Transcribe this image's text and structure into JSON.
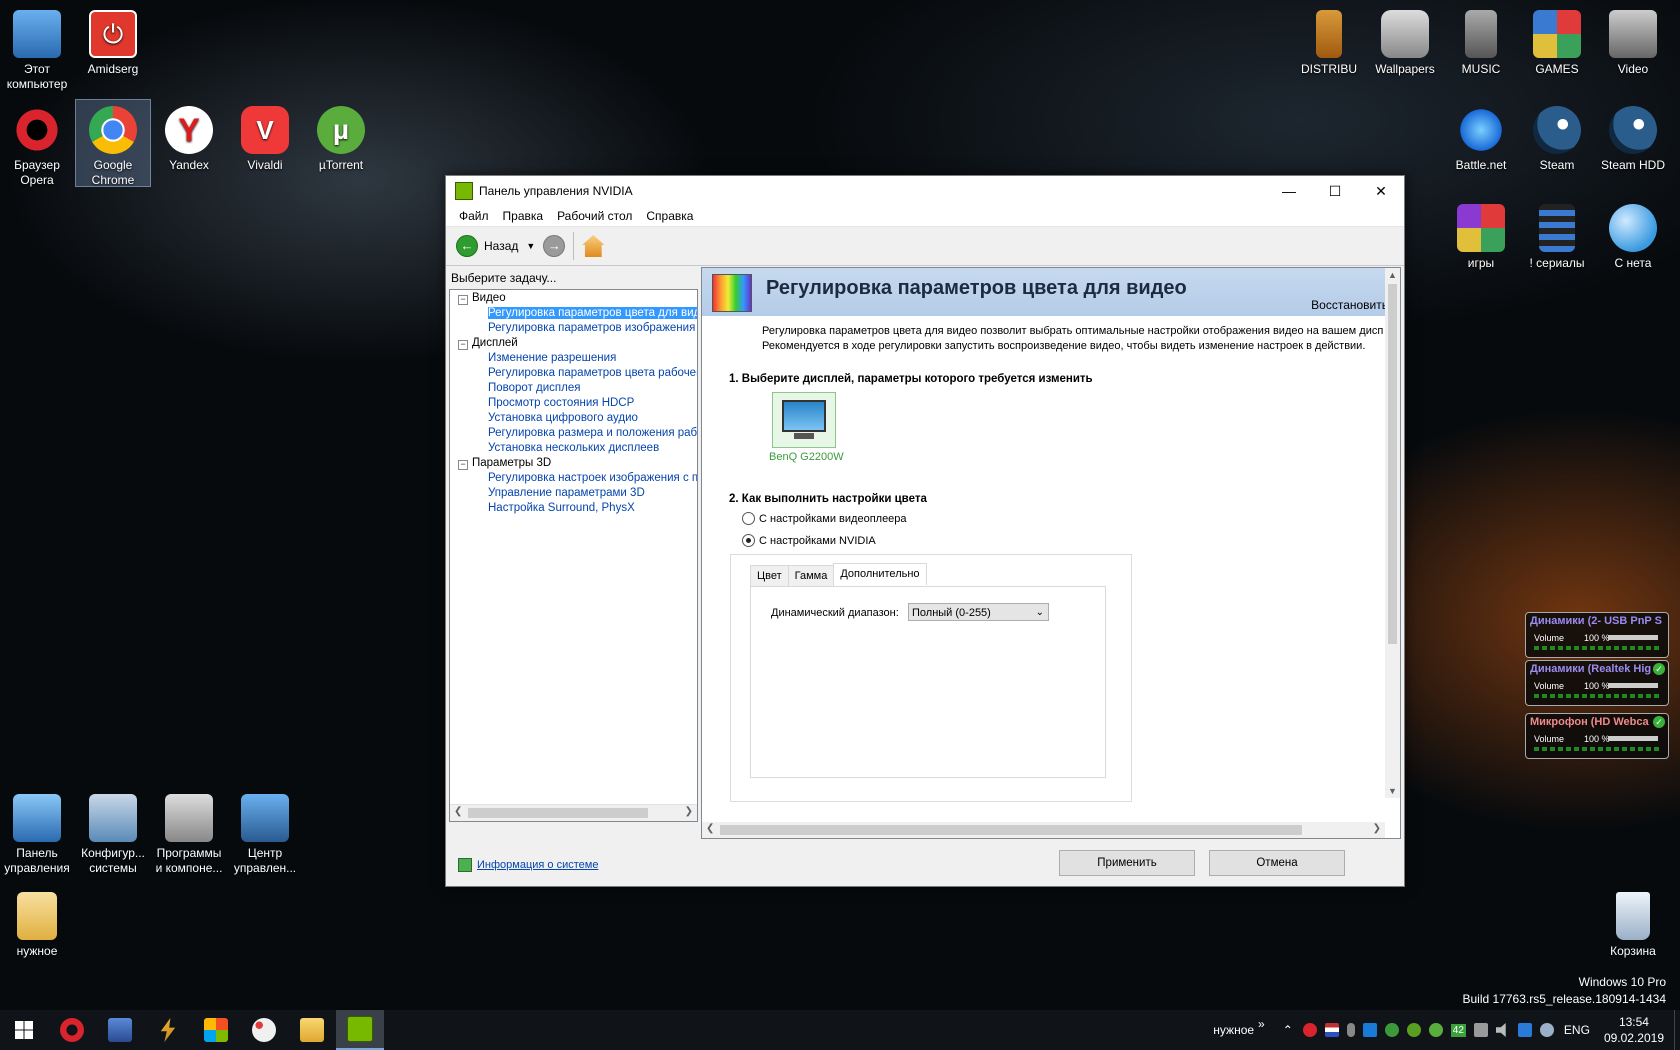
{
  "desktop": {
    "icons_left": [
      {
        "label": "Этот компьютер",
        "color": "#4a90d9"
      },
      {
        "label": "Amidserg",
        "color": "#e0382c"
      },
      {
        "label": "Браузер Opera",
        "color": "#d9232d"
      },
      {
        "label": "Google Chrome",
        "color": "#4285f4"
      },
      {
        "label": "Yandex",
        "color": "#e01a1a"
      },
      {
        "label": "Vivaldi",
        "color": "#ef3939"
      },
      {
        "label": "µTorrent",
        "color": "#5aad3c"
      }
    ],
    "icons_right": [
      {
        "label": "DISTRIBU",
        "color": "#c87a20"
      },
      {
        "label": "Wallpapers",
        "color": "#9a9a9a"
      },
      {
        "label": "MUSIC",
        "color": "#777777"
      },
      {
        "label": "GAMES",
        "color": "#3aa05a"
      },
      {
        "label": "Video",
        "color": "#8a8a8a"
      },
      {
        "label": "Battle.net",
        "color": "#1a8ad8"
      },
      {
        "label": "Steam",
        "color": "#1b3a5c"
      },
      {
        "label": "Steam HDD",
        "color": "#1b3a5c"
      },
      {
        "label": "игры",
        "color": "#d94a3a"
      },
      {
        "label": "! сериалы",
        "color": "#3a7ad0"
      },
      {
        "label": "С нета",
        "color": "#3a9ae0"
      }
    ],
    "icons_bottom": [
      {
        "label": "Панель управления",
        "color": "#3a8ad8"
      },
      {
        "label": "Конфигур... системы",
        "color": "#5a8ab8"
      },
      {
        "label": "Программы и компоне...",
        "color": "#8a8a8a"
      },
      {
        "label": "Центр управлен...",
        "color": "#3a7ad0"
      },
      {
        "label": "нужное",
        "color": "#e8c060"
      }
    ],
    "recycle_bin": {
      "label": "Корзина",
      "color": "#b8c8d8"
    }
  },
  "window": {
    "title": "Панель управления NVIDIA",
    "menu": [
      "Файл",
      "Правка",
      "Рабочий стол",
      "Справка"
    ],
    "toolbar": {
      "back_label": "Назад"
    },
    "left": {
      "header": "Выберите задачу...",
      "tree": [
        {
          "label": "Видео",
          "kind": "cat"
        },
        {
          "label": "Регулировка параметров цвета для вид",
          "kind": "sel"
        },
        {
          "label": "Регулировка параметров изображения д",
          "kind": "link"
        },
        {
          "label": "Дисплей",
          "kind": "cat"
        },
        {
          "label": "Изменение разрешения",
          "kind": "link"
        },
        {
          "label": "Регулировка параметров цвета рабочег",
          "kind": "link"
        },
        {
          "label": "Поворот дисплея",
          "kind": "link"
        },
        {
          "label": "Просмотр состояния HDCP",
          "kind": "link"
        },
        {
          "label": "Установка цифрового аудио",
          "kind": "link"
        },
        {
          "label": "Регулировка размера и положения рабо",
          "kind": "link"
        },
        {
          "label": "Установка нескольких дисплеев",
          "kind": "link"
        },
        {
          "label": "Параметры 3D",
          "kind": "cat"
        },
        {
          "label": "Регулировка настроек изображения с пр",
          "kind": "link"
        },
        {
          "label": "Управление параметрами 3D",
          "kind": "link"
        },
        {
          "label": "Настройка Surround, PhysX",
          "kind": "link"
        }
      ]
    },
    "right": {
      "title": "Регулировка параметров цвета для видео",
      "restore": "Восстановить",
      "desc_line1": "Регулировка параметров цвета для видео позволит выбрать оптимальные настройки отображения видео на вашем дисп",
      "desc_line2": "Рекомендуется в ходе регулировки запустить воспроизведение видео, чтобы видеть изменение настроек в действии.",
      "section1": "1. Выберите дисплей, параметры которого требуется изменить",
      "display_name": "BenQ G2200W",
      "section2": "2. Как выполнить настройки цвета",
      "radio_player": "С настройками видеоплеера",
      "radio_nvidia": "С настройками NVIDIA",
      "tabs": [
        "Цвет",
        "Гамма",
        "Дополнительно"
      ],
      "active_tab": 2,
      "dynamic_range_label": "Динамический диапазон:",
      "dynamic_range_value": "Полный (0-255)"
    },
    "footer": {
      "sysinfo": "Информация о системе",
      "apply": "Применить",
      "cancel": "Отмена"
    }
  },
  "volume_gadgets": [
    {
      "title": "Динамики (2- USB PnP So",
      "label": "Volume",
      "percent": "100 %",
      "title_color": "#9a8cf0",
      "level": 1.0
    },
    {
      "title": "Динамики (Realtek Hig",
      "label": "Volume",
      "percent": "100 %",
      "title_color": "#9a8cf0",
      "level": 1.0
    },
    {
      "title": "Микрофон (HD Webca",
      "label": "Volume",
      "percent": "100 %",
      "title_color": "#f08a8a",
      "level": 1.0
    }
  ],
  "taskbar": {
    "folder_label": "нужное",
    "tray_chevron": "»",
    "tray_badge": "42",
    "lang": "ENG",
    "time": "13:54",
    "date": "09.02.2019"
  },
  "watermark": {
    "line1": "Windows 10 Pro",
    "line2": "Build 17763.rs5_release.180914-1434"
  }
}
